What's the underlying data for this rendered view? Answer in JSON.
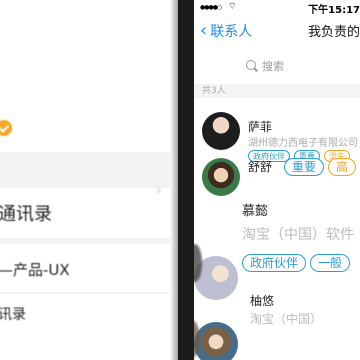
{
  "left": {
    "row1_text": "通讯录",
    "row2_text": "—产品-UX",
    "row3_text": "讯录"
  },
  "statusbar": {
    "signal": "●●●●○",
    "time": "下午15:17"
  },
  "navbar": {
    "back_label": "联系人",
    "title": "我负责的"
  },
  "search": {
    "placeholder": "搜索"
  },
  "section": {
    "count_label": "共3人"
  },
  "contacts": [
    {
      "name": "萨菲",
      "company": "湖州德力西电子有限公司",
      "tags": [
        {
          "label": "政府伙伴",
          "color": "blue"
        },
        {
          "label": "重要",
          "color": "blue"
        },
        {
          "label": "流失",
          "color": "orange"
        }
      ]
    },
    {
      "name": "舒舒",
      "tags": [
        {
          "label": "重要",
          "color": "blue"
        },
        {
          "label": "高",
          "color": "orange"
        }
      ]
    },
    {
      "name": "慕懿"
    },
    {
      "company": "淘宝（中国）软件",
      "tags": [
        {
          "label": "政府伙伴",
          "color": "blue"
        },
        {
          "label": "一般",
          "color": "blue"
        }
      ]
    },
    {
      "name": "柚悠",
      "company": "淘宝（中国）"
    }
  ]
}
